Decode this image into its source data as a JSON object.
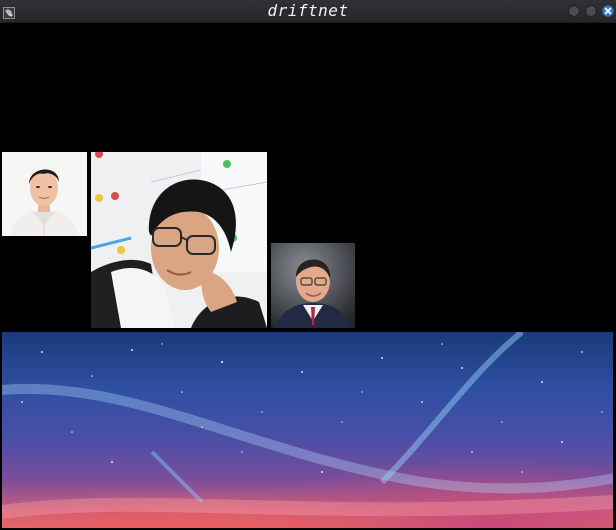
{
  "window": {
    "title": "driftnet",
    "app_icon": "driftnet-app-icon",
    "controls": [
      "minimize-icon",
      "maximize-icon",
      "close-icon"
    ],
    "accent_color": "#3b82d6"
  },
  "captured_images": [
    {
      "name": "portrait-young-man-white-shirt"
    },
    {
      "name": "portrait-man-glasses-leaning-on-hand"
    },
    {
      "name": "portrait-older-man-glasses-suit"
    },
    {
      "name": "starry-night-sky-banner"
    }
  ]
}
